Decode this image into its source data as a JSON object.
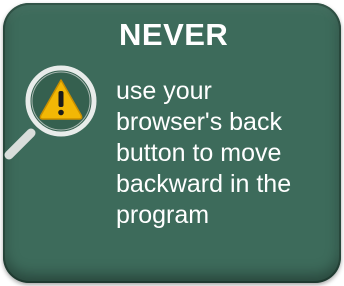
{
  "notice": {
    "heading": "NEVER",
    "lines": [
      "use your",
      "browser's back",
      "button to move",
      "backward in the",
      "program"
    ],
    "icon": "warning-magnifier-icon",
    "colors": {
      "card_background": "#3d6b5b",
      "text": "#ffffff",
      "warning_fill": "#f2b705"
    }
  }
}
